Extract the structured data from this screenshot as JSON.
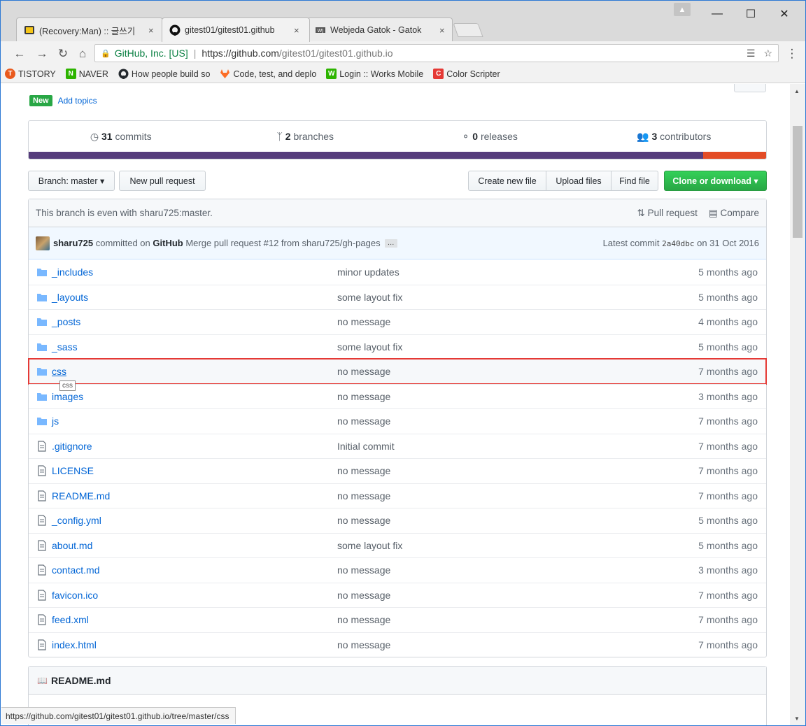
{
  "browser": {
    "tabs": [
      {
        "title": "(Recovery:Man) :: 글쓰기",
        "icon": "tistory-favicon-icon"
      },
      {
        "title": "gitest01/gitest01.github",
        "icon": "github-favicon-icon"
      },
      {
        "title": "Webjeda Gatok - Gatok",
        "icon": "webjeda-favicon-icon"
      }
    ],
    "tab_close": "×",
    "omnibox": {
      "org": "GitHub, Inc. [US]",
      "separator": "|",
      "url_host": "https://github.com",
      "url_rest": "/gitest01/gitest01.github.io"
    },
    "bookmarks": [
      {
        "label": "TISTORY",
        "icon": "tistory-icon",
        "color": "#e9591c",
        "glyph": "T"
      },
      {
        "label": "NAVER",
        "icon": "naver-icon",
        "color": "#2db400",
        "glyph": "N"
      },
      {
        "label": "How people build so",
        "icon": "github-icon",
        "color": "#24292e",
        "glyph": ""
      },
      {
        "label": "Code, test, and deplo",
        "icon": "gitlab-icon",
        "color": "#fc6d26",
        "glyph": ""
      },
      {
        "label": "Login :: Works Mobile",
        "icon": "works-mobile-icon",
        "color": "#2db400",
        "glyph": "W"
      },
      {
        "label": "Color Scripter",
        "icon": "color-scripter-icon",
        "color": "#e53935",
        "glyph": "C"
      }
    ],
    "status_url": "https://github.com/gitest01/gitest01.github.io/tree/master/css"
  },
  "repo": {
    "topics_badge": "New",
    "add_topics": "Add topics",
    "summary": [
      {
        "count": "31",
        "label": "commits",
        "icon": "history-icon"
      },
      {
        "count": "2",
        "label": "branches",
        "icon": "branch-icon"
      },
      {
        "count": "0",
        "label": "releases",
        "icon": "tag-icon"
      },
      {
        "count": "3",
        "label": "contributors",
        "icon": "people-icon"
      }
    ],
    "language_colors": [
      "#563d7c",
      "#e34c26"
    ],
    "branch_button": "Branch: master ▾",
    "new_pr_button": "New pull request",
    "create_file_button": "Create new file",
    "upload_button": "Upload files",
    "find_button": "Find file",
    "clone_button": "Clone or download ▾",
    "branch_status": "This branch is even with sharu725:master.",
    "pull_request_link": "Pull request",
    "compare_link": "Compare",
    "commit": {
      "author": "sharu725",
      "committed_on": "committed on",
      "via": "GitHub",
      "message": "Merge pull request #12 from sharu725/gh-pages",
      "ellipsis": "…",
      "latest_label": "Latest commit",
      "sha": "2a40dbc",
      "date": "on 31 Oct 2016"
    },
    "files": [
      {
        "name": "_includes",
        "type": "dir",
        "message": "minor updates",
        "age": "5 months ago"
      },
      {
        "name": "_layouts",
        "type": "dir",
        "message": "some layout fix",
        "age": "5 months ago"
      },
      {
        "name": "_posts",
        "type": "dir",
        "message": "no message",
        "age": "4 months ago"
      },
      {
        "name": "_sass",
        "type": "dir",
        "message": "some layout fix",
        "age": "5 months ago"
      },
      {
        "name": "css",
        "type": "dir",
        "message": "no message",
        "age": "7 months ago"
      },
      {
        "name": "images",
        "type": "dir",
        "message": "no message",
        "age": "3 months ago"
      },
      {
        "name": "js",
        "type": "dir",
        "message": "no message",
        "age": "7 months ago"
      },
      {
        "name": ".gitignore",
        "type": "file",
        "message": "Initial commit",
        "age": "7 months ago"
      },
      {
        "name": "LICENSE",
        "type": "file",
        "message": "no message",
        "age": "7 months ago"
      },
      {
        "name": "README.md",
        "type": "file",
        "message": "no message",
        "age": "7 months ago"
      },
      {
        "name": "_config.yml",
        "type": "file",
        "message": "no message",
        "age": "5 months ago"
      },
      {
        "name": "about.md",
        "type": "file",
        "message": "some layout fix",
        "age": "5 months ago"
      },
      {
        "name": "contact.md",
        "type": "file",
        "message": "no message",
        "age": "3 months ago"
      },
      {
        "name": "favicon.ico",
        "type": "file",
        "message": "no message",
        "age": "7 months ago"
      },
      {
        "name": "feed.xml",
        "type": "file",
        "message": "no message",
        "age": "7 months ago"
      },
      {
        "name": "index.html",
        "type": "file",
        "message": "no message",
        "age": "7 months ago"
      }
    ],
    "tooltip": "css",
    "readme_title": "README.md"
  }
}
